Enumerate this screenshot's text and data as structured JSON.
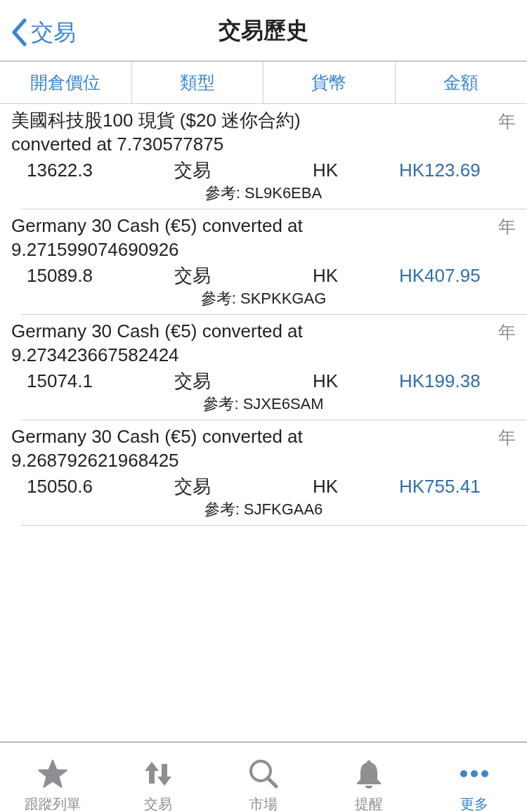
{
  "nav": {
    "back_label": "交易",
    "title": "交易歷史"
  },
  "columns": [
    {
      "label": "開倉價位"
    },
    {
      "label": "類型"
    },
    {
      "label": "貨幣"
    },
    {
      "label": "金額"
    }
  ],
  "rows": [
    {
      "title": "美國科技股100 現貨 ($20 迷你合約) converted at 7.730577875",
      "period": "年",
      "price": "13622.3",
      "type": "交易",
      "currency": "HK",
      "amount": "HK123.69",
      "reference": "參考: SL9K6EBA"
    },
    {
      "title": "Germany 30 Cash (€5) converted at 9.271599074690926",
      "period": "年",
      "price": "15089.8",
      "type": "交易",
      "currency": "HK",
      "amount": "HK407.95",
      "reference": "參考: SKPKKGAG"
    },
    {
      "title": "Germany 30 Cash (€5) converted at 9.273423667582424",
      "period": "年",
      "price": "15074.1",
      "type": "交易",
      "currency": "HK",
      "amount": "HK199.38",
      "reference": "參考: SJXE6SAM"
    },
    {
      "title": "Germany 30 Cash (€5) converted at 9.268792621968425",
      "period": "年",
      "price": "15050.6",
      "type": "交易",
      "currency": "HK",
      "amount": "HK755.41",
      "reference": "參考: SJFKGAA6"
    }
  ],
  "tab_bar": [
    {
      "label": "跟蹤列單",
      "selected": false
    },
    {
      "label": "交易",
      "selected": false
    },
    {
      "label": "市場",
      "selected": false
    },
    {
      "label": "提醒",
      "selected": false
    },
    {
      "label": "更多",
      "selected": true
    }
  ]
}
